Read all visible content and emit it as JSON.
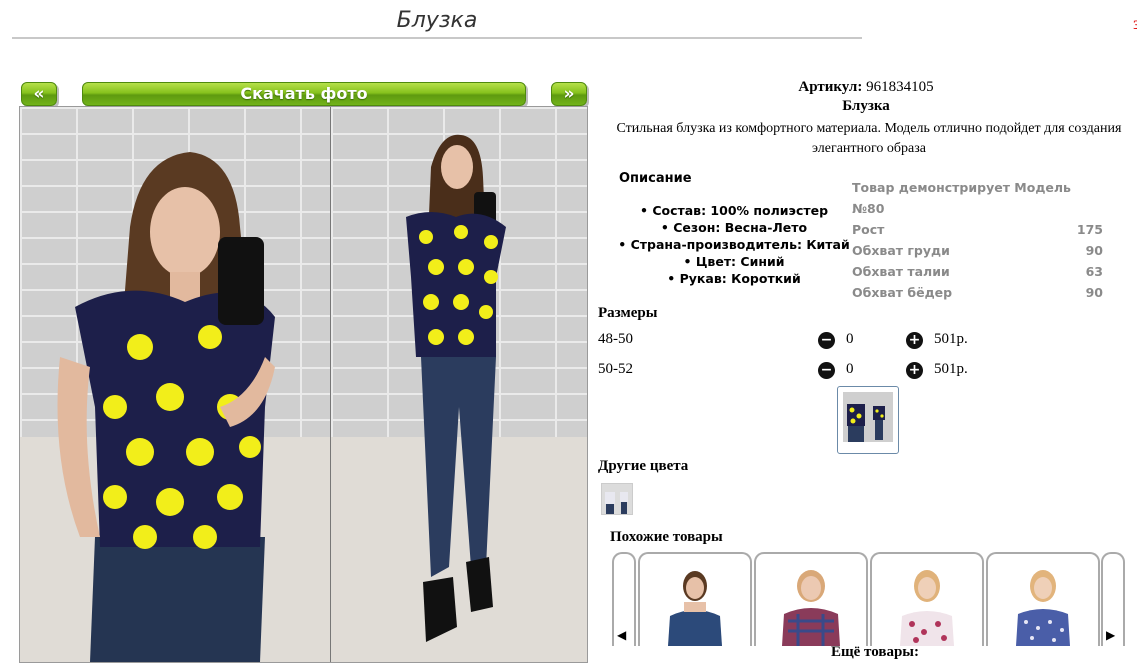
{
  "page": {
    "title": "Блузка",
    "side_mark": "з"
  },
  "gallery": {
    "prev_label": "«",
    "next_label": "»",
    "download_label": "Скачать фото"
  },
  "product": {
    "article_label": "Артикул:",
    "article_value": "961834105",
    "name": "Блузка",
    "description": "Стильная блузка из комфортного материала. Модель отлично подойдет для создания элегантного образа"
  },
  "details": {
    "title": "Описание",
    "items": [
      "Состав: 100% полиэстер",
      "Сезон: Весна-Лето",
      "Страна-производитель: Китай",
      "Цвет: Синий",
      "Рукав: Короткий"
    ]
  },
  "model": {
    "title": "Товар демонстрирует Модель №80",
    "rows": [
      {
        "label": "Рост",
        "value": "175"
      },
      {
        "label": "Обхват груди",
        "value": "90"
      },
      {
        "label": "Обхват талии",
        "value": "63"
      },
      {
        "label": "Обхват бёдер",
        "value": "90"
      }
    ]
  },
  "sizes": {
    "title": "Размеры",
    "rows": [
      {
        "label": "48-50",
        "qty": "0",
        "price": "501р."
      },
      {
        "label": "50-52",
        "qty": "0",
        "price": "501р."
      }
    ]
  },
  "other_colors": {
    "title": "Другие цвета"
  },
  "similar": {
    "title": "Похожие товары",
    "more": "Ещё товары:",
    "prev_icon": "◀",
    "next_icon": "▶"
  },
  "icons": {
    "minus": "minus-circle-icon",
    "plus": "plus-circle-icon"
  },
  "colors": {
    "accent_green": "#86c21d",
    "blouse_navy": "#1d1f4a",
    "dots_yellow": "#f2ee1a"
  }
}
